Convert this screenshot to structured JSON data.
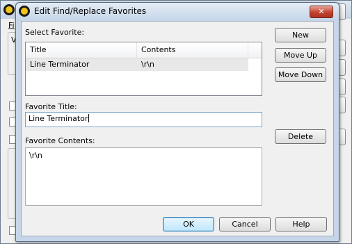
{
  "dialog": {
    "title": "Edit Find/Replace Favorites",
    "close_glyph": "✕"
  },
  "select_favorite": {
    "label": "Select Favorite:",
    "columns": [
      "Title",
      "Contents"
    ],
    "rows": [
      {
        "title": "Line Terminator",
        "contents": "\\r\\n"
      }
    ]
  },
  "favorite_title": {
    "label": "Favorite Title:",
    "value": "Line Terminator"
  },
  "favorite_contents": {
    "label": "Favorite Contents:",
    "value": "\\r\\n"
  },
  "buttons": {
    "new": "New",
    "move_up": "Move Up",
    "move_down": "Move Down",
    "delete": "Delete",
    "ok": "OK",
    "cancel": "Cancel",
    "help": "Help"
  },
  "background_window": {
    "menu_fragment": "Fi",
    "text_fragment": "V"
  },
  "colors": {
    "close_button": "#c2422f",
    "selection_row": "#e8e8e8",
    "default_button_border": "#3c7fb1"
  }
}
